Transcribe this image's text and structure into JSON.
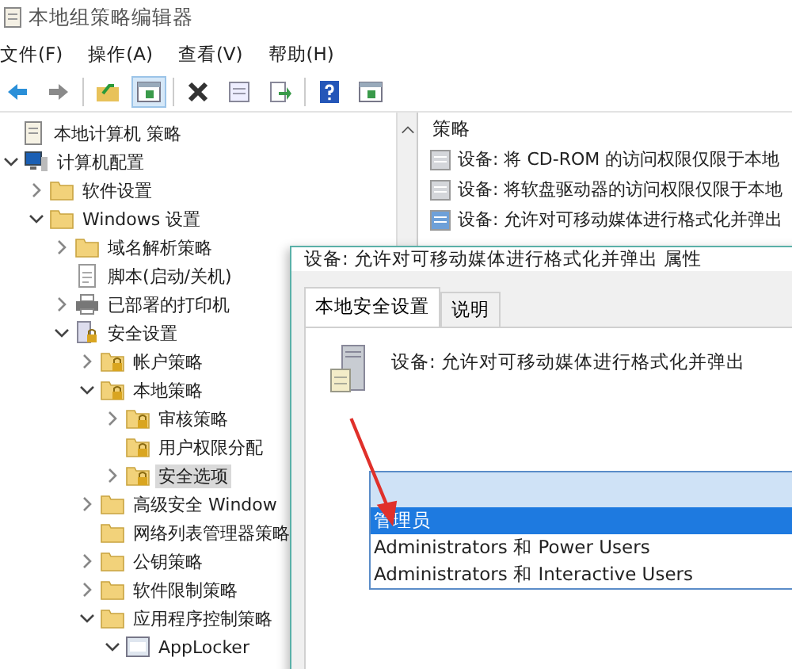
{
  "window": {
    "title": "本地组策略编辑器"
  },
  "menu": [
    "文件(F)",
    "操作(A)",
    "查看(V)",
    "帮助(H)"
  ],
  "toolbar": [
    {
      "kind": "back"
    },
    {
      "kind": "forward"
    },
    {
      "kind": "sep"
    },
    {
      "kind": "up"
    },
    {
      "kind": "panel",
      "selected": true
    },
    {
      "kind": "sep"
    },
    {
      "kind": "delete"
    },
    {
      "kind": "properties"
    },
    {
      "kind": "export"
    },
    {
      "kind": "sep"
    },
    {
      "kind": "help"
    },
    {
      "kind": "panel",
      "selected": false
    }
  ],
  "tree": [
    {
      "label": "本地计算机 策略",
      "kind": "policy",
      "selected": false,
      "children": [
        {
          "label": "计算机配置",
          "kind": "computer",
          "expanded": true,
          "selected": false,
          "children": [
            {
              "label": "软件设置",
              "kind": "folder",
              "expanded": false,
              "selected": false
            },
            {
              "label": "Windows 设置",
              "kind": "folder",
              "expanded": true,
              "selected": false,
              "children": [
                {
                  "label": "域名解析策略",
                  "kind": "folder",
                  "expanded": false,
                  "selected": false
                },
                {
                  "label": "脚本(启动/关机)",
                  "kind": "script",
                  "selected": false
                },
                {
                  "label": "已部署的打印机",
                  "kind": "printer",
                  "expanded": false,
                  "selected": false
                },
                {
                  "label": "安全设置",
                  "kind": "security",
                  "expanded": true,
                  "selected": false,
                  "children": [
                    {
                      "label": "帐户策略",
                      "kind": "lockfolder",
                      "expanded": false,
                      "selected": false
                    },
                    {
                      "label": "本地策略",
                      "kind": "lockfolder",
                      "expanded": true,
                      "selected": false,
                      "children": [
                        {
                          "label": "审核策略",
                          "kind": "lockfolder",
                          "expanded": false,
                          "selected": false
                        },
                        {
                          "label": "用户权限分配",
                          "kind": "lockfolder",
                          "selected": false
                        },
                        {
                          "label": "安全选项",
                          "kind": "lockfolder",
                          "expanded": false,
                          "selected": true
                        }
                      ]
                    },
                    {
                      "label": "高级安全 Window",
                      "kind": "folder",
                      "expanded": false,
                      "selected": false
                    },
                    {
                      "label": "网络列表管理器策略",
                      "kind": "folder",
                      "selected": false
                    },
                    {
                      "label": "公钥策略",
                      "kind": "folder",
                      "expanded": false,
                      "selected": false
                    },
                    {
                      "label": "软件限制策略",
                      "kind": "folder",
                      "expanded": false,
                      "selected": false
                    },
                    {
                      "label": "应用程序控制策略",
                      "kind": "folder",
                      "expanded": true,
                      "selected": false,
                      "children": [
                        {
                          "label": "AppLocker",
                          "kind": "applocker",
                          "expanded": true,
                          "selected": false
                        }
                      ]
                    }
                  ]
                }
              ]
            }
          ]
        }
      ]
    }
  ],
  "policy_list": {
    "header": "策略",
    "items": [
      {
        "label": "设备: 将 CD-ROM 的访问权限仅限于本地",
        "selected": false
      },
      {
        "label": "设备: 将软盘驱动器的访问权限仅限于本地",
        "selected": false
      },
      {
        "label": "设备: 允许对可移动媒体进行格式化并弹出",
        "selected": true
      }
    ]
  },
  "dialog": {
    "title": "设备: 允许对可移动媒体进行格式化并弹出 属性",
    "tabs": [
      {
        "label": "本地安全设置",
        "selected": true
      },
      {
        "label": "说明",
        "selected": false
      }
    ],
    "setting_name": "设备: 允许对可移动媒体进行格式化并弹出",
    "dropdown_options": [
      {
        "label": "管理员",
        "selected": true
      },
      {
        "label": "Administrators 和 Power Users",
        "selected": false
      },
      {
        "label": "Administrators 和 Interactive Users",
        "selected": false
      }
    ]
  }
}
